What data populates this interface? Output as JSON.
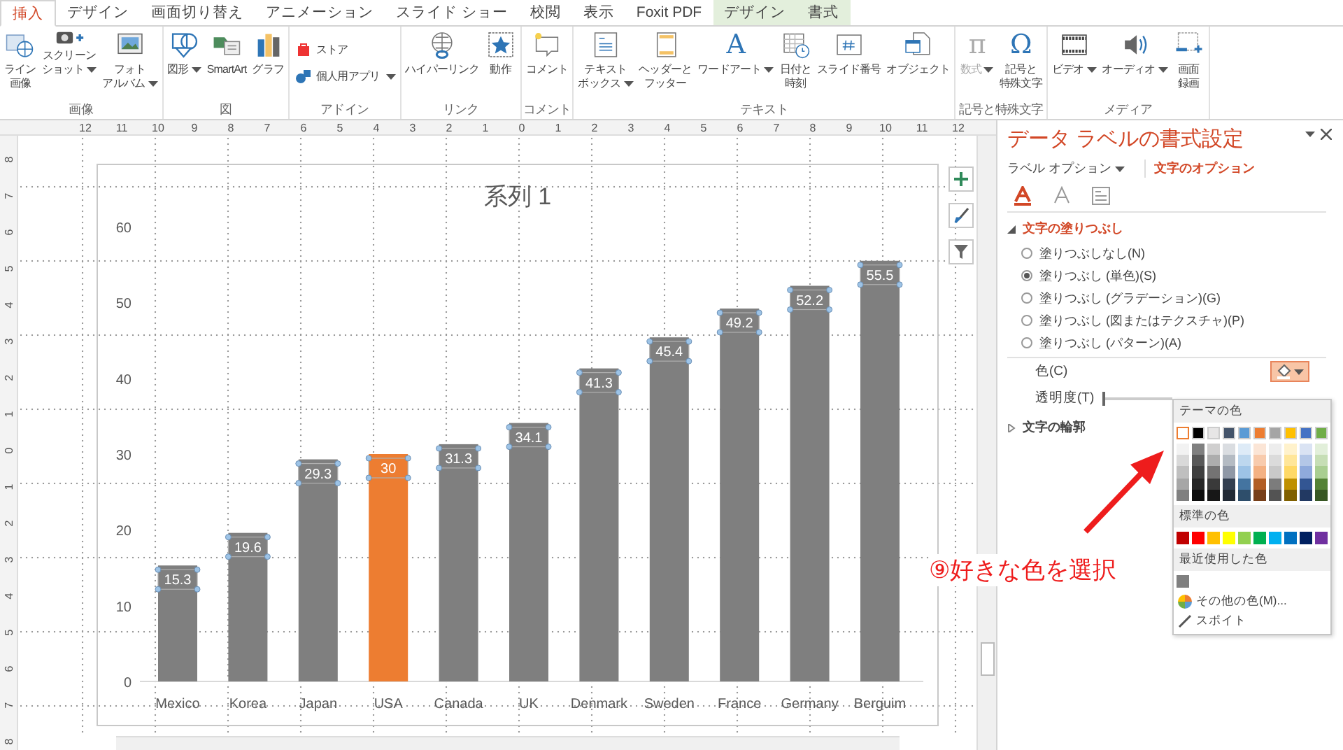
{
  "tabs": [
    {
      "label": "挿入",
      "selected": true,
      "contextual": false
    },
    {
      "label": "デザイン",
      "selected": false,
      "contextual": false
    },
    {
      "label": "画面切り替え",
      "selected": false,
      "contextual": false
    },
    {
      "label": "アニメーション",
      "selected": false,
      "contextual": false
    },
    {
      "label": "スライド ショー",
      "selected": false,
      "contextual": false
    },
    {
      "label": "校閲",
      "selected": false,
      "contextual": false
    },
    {
      "label": "表示",
      "selected": false,
      "contextual": false
    },
    {
      "label": "Foxit PDF",
      "selected": false,
      "contextual": false
    },
    {
      "label": "デザイン",
      "selected": false,
      "contextual": true
    },
    {
      "label": "書式",
      "selected": false,
      "contextual": true
    }
  ],
  "ribbon": {
    "groups": [
      {
        "label": "画像",
        "items": [
          {
            "kind": "large",
            "label": [
              "ライン",
              "画像"
            ],
            "dropdown": false,
            "disabled": false
          },
          {
            "kind": "large",
            "label": [
              "スクリーン",
              "ショット"
            ],
            "dropdown": true,
            "disabled": false
          },
          {
            "kind": "large",
            "label": [
              "フォト",
              "アルバム"
            ],
            "dropdown": true,
            "disabled": false
          }
        ]
      },
      {
        "label": "図",
        "items": [
          {
            "kind": "large",
            "label": [
              "図形"
            ],
            "dropdown": true,
            "disabled": false
          },
          {
            "kind": "large",
            "label": [
              "SmartArt"
            ],
            "dropdown": false,
            "disabled": false
          },
          {
            "kind": "large",
            "label": [
              "グラフ"
            ],
            "dropdown": false,
            "disabled": false
          }
        ]
      },
      {
        "label": "アドイン",
        "items": [
          {
            "kind": "small",
            "label": [
              "ストア"
            ],
            "dropdown": false,
            "disabled": false
          },
          {
            "kind": "small",
            "label": [
              "個人用アプリ"
            ],
            "dropdown": true,
            "disabled": false
          }
        ]
      },
      {
        "label": "リンク",
        "items": [
          {
            "kind": "large",
            "label": [
              "ハイパーリンク"
            ],
            "dropdown": false,
            "disabled": false
          },
          {
            "kind": "large",
            "label": [
              "動作"
            ],
            "dropdown": false,
            "disabled": false
          }
        ]
      },
      {
        "label": "コメント",
        "items": [
          {
            "kind": "large",
            "label": [
              "コメント"
            ],
            "dropdown": false,
            "disabled": false
          }
        ]
      },
      {
        "label": "テキスト",
        "items": [
          {
            "kind": "large",
            "label": [
              "テキスト",
              "ボックス"
            ],
            "dropdown": true,
            "disabled": false
          },
          {
            "kind": "large",
            "label": [
              "ヘッダーと",
              "フッター"
            ],
            "dropdown": false,
            "disabled": false
          },
          {
            "kind": "large",
            "glyph": "A",
            "label": [
              "ワードアート"
            ],
            "dropdown": true,
            "disabled": false
          },
          {
            "kind": "large",
            "label": [
              "日付と",
              "時刻"
            ],
            "dropdown": false,
            "disabled": false
          },
          {
            "kind": "large",
            "label": [
              "スライド番号"
            ],
            "dropdown": false,
            "disabled": false
          },
          {
            "kind": "large",
            "label": [
              "オブジェクト"
            ],
            "dropdown": false,
            "disabled": false
          }
        ]
      },
      {
        "label": "記号と特殊文字",
        "items": [
          {
            "kind": "large",
            "glyph": "π",
            "label": [
              "数式"
            ],
            "dropdown": true,
            "disabled": true
          },
          {
            "kind": "large",
            "glyph": "Ω",
            "label": [
              "記号と",
              "特殊文字"
            ],
            "dropdown": false,
            "disabled": false
          }
        ]
      },
      {
        "label": "メディア",
        "items": [
          {
            "kind": "large",
            "label": [
              "ビデオ"
            ],
            "dropdown": true,
            "disabled": false
          },
          {
            "kind": "large",
            "label": [
              "オーディオ"
            ],
            "dropdown": true,
            "disabled": false
          },
          {
            "kind": "large",
            "label": [
              "画面",
              "録画"
            ],
            "dropdown": false,
            "disabled": false
          }
        ]
      }
    ]
  },
  "ruler": {
    "horizontal": [
      "12",
      "11",
      "10",
      "9",
      "8",
      "7",
      "6",
      "5",
      "4",
      "3",
      "2",
      "1",
      "0",
      "1",
      "2",
      "3",
      "4",
      "5",
      "6",
      "7",
      "8",
      "9",
      "10",
      "11",
      "12"
    ],
    "vertical": [
      "8",
      "7",
      "6",
      "5",
      "4",
      "3",
      "2",
      "1",
      "0",
      "1",
      "2",
      "3",
      "4",
      "5",
      "6",
      "7",
      "8"
    ]
  },
  "chart": {
    "chart_data": {
      "type": "bar",
      "title": "系列 1",
      "categories": [
        "Mexico",
        "Korea",
        "Japan",
        "USA",
        "Canada",
        "UK",
        "Denmark",
        "Sweden",
        "France",
        "Germany",
        "Berguim"
      ],
      "series": [
        {
          "color": "#7f7f7f",
          "values": [
            15.3,
            19.6,
            29.3,
            null,
            31.3,
            34.1,
            41.3,
            45.4,
            49.2,
            52.2,
            55.5
          ]
        },
        {
          "color": "#ed7d31",
          "values": [
            null,
            null,
            null,
            30,
            null,
            null,
            null,
            null,
            null,
            null,
            null
          ]
        }
      ],
      "stacked": true,
      "ylim": [
        0,
        60
      ],
      "yticks": [
        0,
        10,
        20,
        30,
        40,
        50,
        60
      ],
      "data_labels": true
    }
  },
  "format_pane": {
    "title": "データ ラベルの書式設定",
    "tabs": [
      {
        "label": "ラベル オプション",
        "selected": false
      },
      {
        "label": "文字のオプション",
        "selected": true
      }
    ],
    "icon_tabs": [
      {
        "selected": true
      },
      {
        "selected": false
      },
      {
        "selected": false
      }
    ],
    "fill_section": {
      "title": "文字の塗りつぶし",
      "expanded": true,
      "options": [
        {
          "label": "塗りつぶしなし(N)",
          "selected": false
        },
        {
          "label": "塗りつぶし (単色)(S)",
          "selected": true
        },
        {
          "label": "塗りつぶし (グラデーション)(G)",
          "selected": false
        },
        {
          "label": "塗りつぶし (図またはテクスチャ)(P)",
          "selected": false
        },
        {
          "label": "塗りつぶし (パターン)(A)",
          "selected": false
        }
      ],
      "color_label": "色(C)",
      "transparency_label": "透明度(T)",
      "transparency": {
        "level": 0
      }
    },
    "outline_section": {
      "title": "文字の輪郭",
      "expanded": false
    }
  },
  "color_picker": {
    "theme_title": "テーマの色",
    "theme_colors": [
      {
        "color": "#ffffff",
        "selected": true
      },
      {
        "color": "#000000",
        "selected": false
      },
      {
        "color": "#e7e6e6",
        "selected": false
      },
      {
        "color": "#44546a",
        "selected": false
      },
      {
        "color": "#5b9bd5",
        "selected": false
      },
      {
        "color": "#ed7d31",
        "selected": false
      },
      {
        "color": "#a5a5a5",
        "selected": false
      },
      {
        "color": "#ffc000",
        "selected": false
      },
      {
        "color": "#4472c4",
        "selected": false
      },
      {
        "color": "#70ad47",
        "selected": false
      }
    ],
    "standard_title": "標準の色",
    "standard_colors": [
      {
        "color": "#c00000"
      },
      {
        "color": "#ff0000"
      },
      {
        "color": "#ffc000"
      },
      {
        "color": "#ffff00"
      },
      {
        "color": "#92d050"
      },
      {
        "color": "#00b050"
      },
      {
        "color": "#00b0f0"
      },
      {
        "color": "#0070c0"
      },
      {
        "color": "#002060"
      },
      {
        "color": "#7030a0"
      }
    ],
    "recent_title": "最近使用した色",
    "recent_colors": [
      {
        "color": "#7f7f7f"
      }
    ],
    "commands": [
      {
        "kind": "more",
        "label": "その他の色(M)..."
      },
      {
        "kind": "eyedropper",
        "label": "スポイト"
      }
    ]
  },
  "annotation": {
    "text": "⑨好きな色を選択"
  }
}
